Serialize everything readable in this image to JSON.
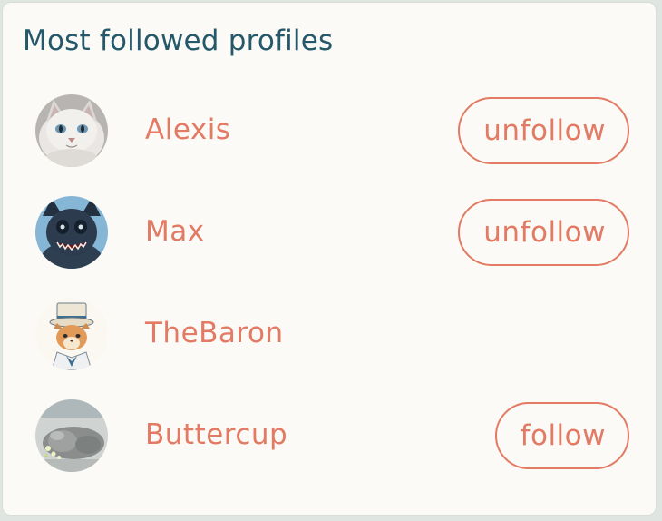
{
  "title": "Most followed profiles",
  "colors": {
    "title": "#24586a",
    "accent": "#e27a64",
    "card_bg": "#fcfaf6"
  },
  "profiles": [
    {
      "name": "Alexis",
      "avatar_icon": "white-cat-avatar",
      "button_label": "unfollow"
    },
    {
      "name": "Max",
      "avatar_icon": "dark-cartoon-creature-avatar",
      "button_label": "unfollow"
    },
    {
      "name": "TheBaron",
      "avatar_icon": "cat-in-top-hat-avatar",
      "button_label": null
    },
    {
      "name": "Buttercup",
      "avatar_icon": "sleeping-cat-avatar",
      "button_label": "follow"
    }
  ]
}
